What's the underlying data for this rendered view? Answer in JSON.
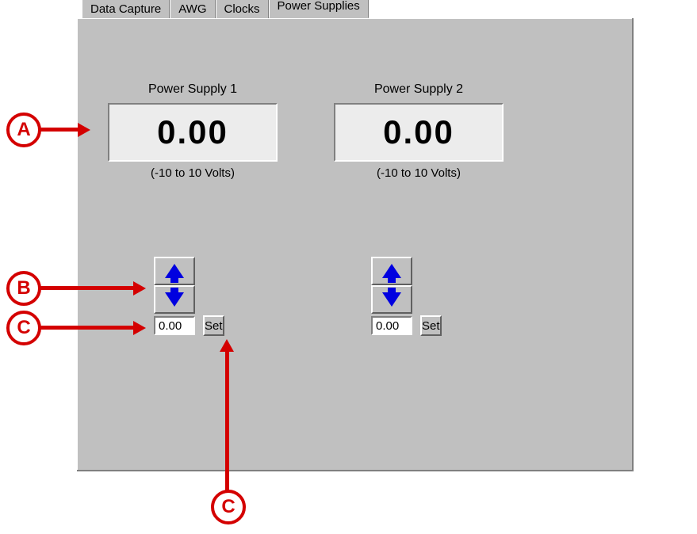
{
  "tabs": [
    {
      "label": "Data Capture",
      "active": false
    },
    {
      "label": "AWG",
      "active": false
    },
    {
      "label": "Clocks",
      "active": false
    },
    {
      "label": "Power Supplies",
      "active": true
    }
  ],
  "supplies": [
    {
      "title": "Power Supply 1",
      "display": "0.00",
      "range": "(-10 to 10 Volts)",
      "input_value": "0.00",
      "set_label": "Set"
    },
    {
      "title": "Power Supply 2",
      "display": "0.00",
      "range": "(-10 to 10 Volts)",
      "input_value": "0.00",
      "set_label": "Set"
    }
  ],
  "annotations": {
    "a": "A",
    "b": "B",
    "c": "C"
  }
}
